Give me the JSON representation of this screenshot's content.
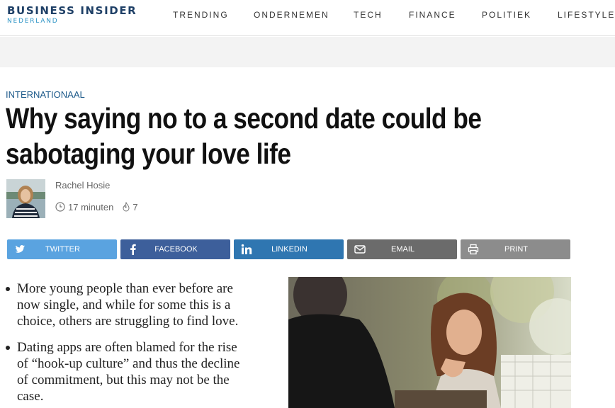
{
  "header": {
    "logo_main": "BUSINESS INSIDER",
    "logo_sub": "NEDERLAND",
    "nav": [
      "TRENDING",
      "ONDERNEMEN",
      "TECH",
      "FINANCE",
      "POLITIEK",
      "LIFESTYLE"
    ]
  },
  "article": {
    "section": "INTERNATIONAAL",
    "title_line1": "Why saying no to a second date could be",
    "title_line2": "sabotaging your love life",
    "author": "Rachel Hosie",
    "read_time": "17 minuten",
    "trending_count": "7",
    "bullets": [
      [
        "More young people than ever before are",
        "now single, and while for some this is a",
        "choice, others are struggling to find love."
      ],
      [
        "Dating apps are often blamed for the rise",
        "of “hook-up culture” and thus the decline",
        "of commitment, but this may not be the",
        "case."
      ]
    ]
  },
  "share": {
    "twitter": "TWITTER",
    "facebook": "FACEBOOK",
    "linkedin": "LINKEDIN",
    "email": "EMAIL",
    "print": "PRINT"
  },
  "icons": {
    "clock": "clock-icon",
    "trending": "flame-icon",
    "twitter": "twitter-icon",
    "facebook": "facebook-icon",
    "linkedin": "linkedin-icon",
    "email": "envelope-icon",
    "print": "printer-icon"
  },
  "colors": {
    "brand": "#1e3f66",
    "section": "#1d5a8a",
    "twitter": "#5aa3e0",
    "facebook": "#3d5f9b",
    "linkedin": "#2f76b1",
    "email": "#6b6b6b",
    "print": "#8c8c8c"
  }
}
